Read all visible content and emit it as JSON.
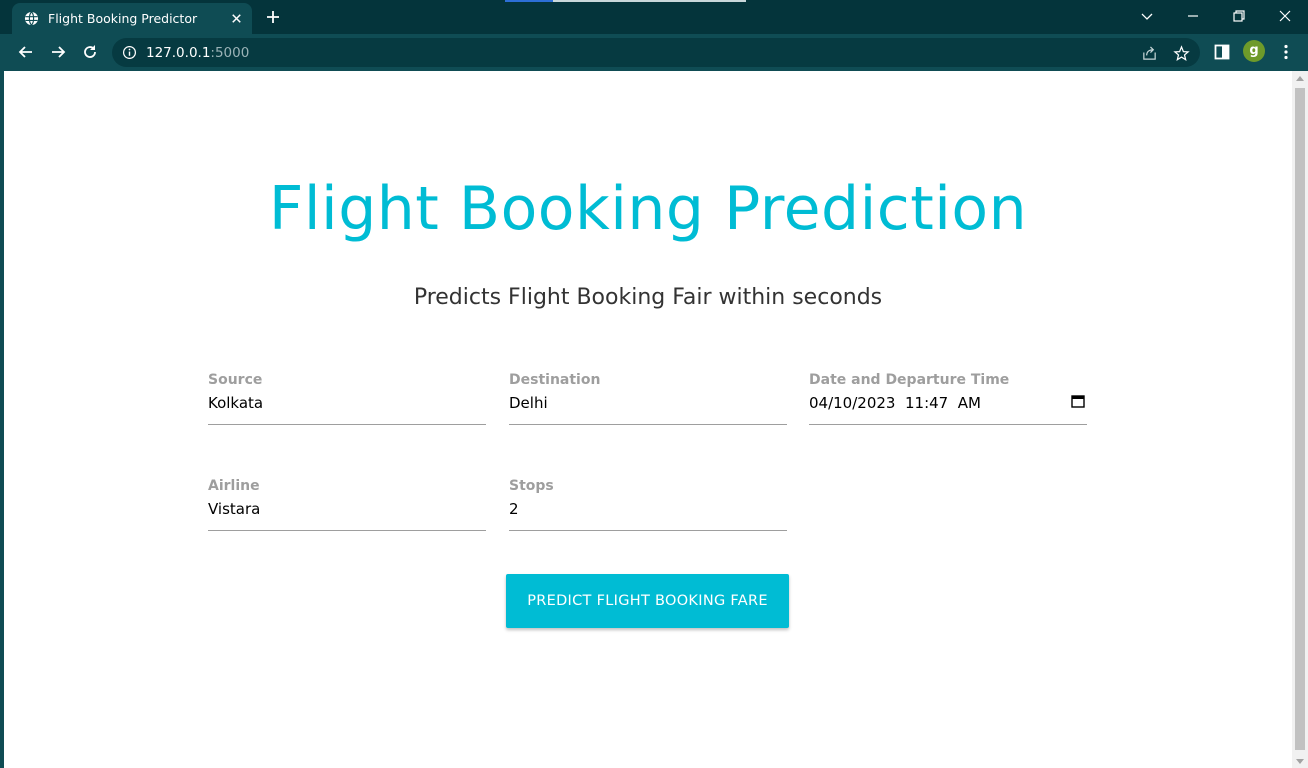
{
  "browser": {
    "tab_title": "Flight Booking Predictor",
    "url_host": "127.0.0.1",
    "url_port": ":5000",
    "profile_initial": "g"
  },
  "page": {
    "title": "Flight Booking Prediction",
    "subtitle": "Predicts Flight Booking Fair within seconds",
    "fields": {
      "source": {
        "label": "Source",
        "value": "Kolkata"
      },
      "destination": {
        "label": "Destination",
        "value": "Delhi"
      },
      "departure": {
        "label": "Date and Departure Time",
        "value": "04/10/2023  11:47  AM"
      },
      "airline": {
        "label": "Airline",
        "value": "Vistara"
      },
      "stops": {
        "label": "Stops",
        "value": "2"
      }
    },
    "button_label": "Predict Flight Booking Fare"
  },
  "colors": {
    "accent": "#00bcd4",
    "chrome_dark": "#04343b",
    "chrome": "#0f4c54",
    "profile": "#6e9a2a"
  },
  "icons": [
    "globe-icon",
    "close-icon",
    "plus-icon",
    "chevron-down-icon",
    "minimize-icon",
    "restore-icon",
    "close-window-icon",
    "back-arrow-icon",
    "forward-arrow-icon",
    "reload-icon",
    "info-icon",
    "share-icon",
    "star-icon",
    "side-panel-icon",
    "kebab-menu-icon",
    "calendar-icon"
  ]
}
